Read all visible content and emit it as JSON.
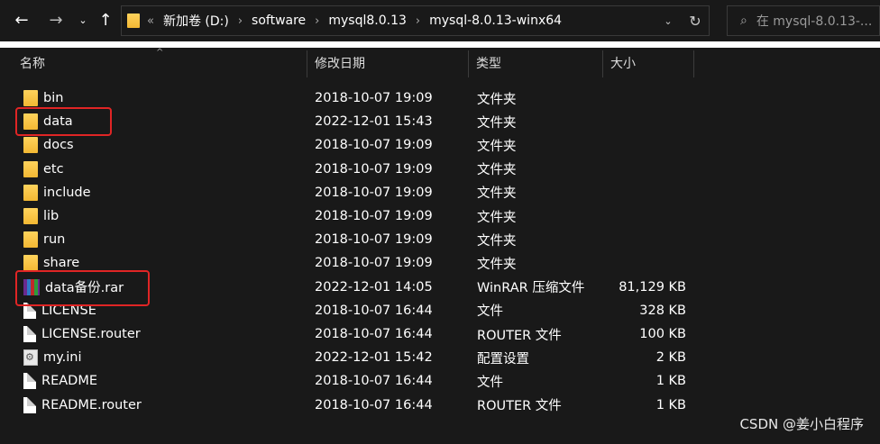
{
  "address_bar": {
    "path": [
      "新加卷 (D:)",
      "software",
      "mysql8.0.13",
      "mysql-8.0.13-winx64"
    ],
    "overflow": "«"
  },
  "search": {
    "placeholder": "在 mysql-8.0.13-..."
  },
  "columns": {
    "name": "名称",
    "date": "修改日期",
    "type": "类型",
    "size": "大小"
  },
  "files": [
    {
      "name": "bin",
      "date": "2018-10-07 19:09",
      "type": "文件夹",
      "size": "",
      "icon": "folder-icon"
    },
    {
      "name": "data",
      "date": "2022-12-01 15:43",
      "type": "文件夹",
      "size": "",
      "icon": "folder-icon",
      "highlighted": true
    },
    {
      "name": "docs",
      "date": "2018-10-07 19:09",
      "type": "文件夹",
      "size": "",
      "icon": "folder-icon"
    },
    {
      "name": "etc",
      "date": "2018-10-07 19:09",
      "type": "文件夹",
      "size": "",
      "icon": "folder-icon"
    },
    {
      "name": "include",
      "date": "2018-10-07 19:09",
      "type": "文件夹",
      "size": "",
      "icon": "folder-icon"
    },
    {
      "name": "lib",
      "date": "2018-10-07 19:09",
      "type": "文件夹",
      "size": "",
      "icon": "folder-icon"
    },
    {
      "name": "run",
      "date": "2018-10-07 19:09",
      "type": "文件夹",
      "size": "",
      "icon": "folder-icon"
    },
    {
      "name": "share",
      "date": "2018-10-07 19:09",
      "type": "文件夹",
      "size": "",
      "icon": "folder-icon"
    },
    {
      "name": "data备份.rar",
      "date": "2022-12-01 14:05",
      "type": "WinRAR 压缩文件",
      "size": "81,129 KB",
      "icon": "winrar-archive-icon",
      "highlighted": true
    },
    {
      "name": "LICENSE",
      "date": "2018-10-07 16:44",
      "type": "文件",
      "size": "328 KB",
      "icon": "file-icon"
    },
    {
      "name": "LICENSE.router",
      "date": "2018-10-07 16:44",
      "type": "ROUTER 文件",
      "size": "100 KB",
      "icon": "file-icon"
    },
    {
      "name": "my.ini",
      "date": "2022-12-01 15:42",
      "type": "配置设置",
      "size": "2 KB",
      "icon": "config-file-icon"
    },
    {
      "name": "README",
      "date": "2018-10-07 16:44",
      "type": "文件",
      "size": "1 KB",
      "icon": "file-icon"
    },
    {
      "name": "README.router",
      "date": "2018-10-07 16:44",
      "type": "ROUTER 文件",
      "size": "1 KB",
      "icon": "file-icon"
    }
  ],
  "watermark": "CSDN @姜小白程序",
  "colors": {
    "background": "#191919",
    "highlight": "#e02525",
    "folder": "#f3b833"
  }
}
